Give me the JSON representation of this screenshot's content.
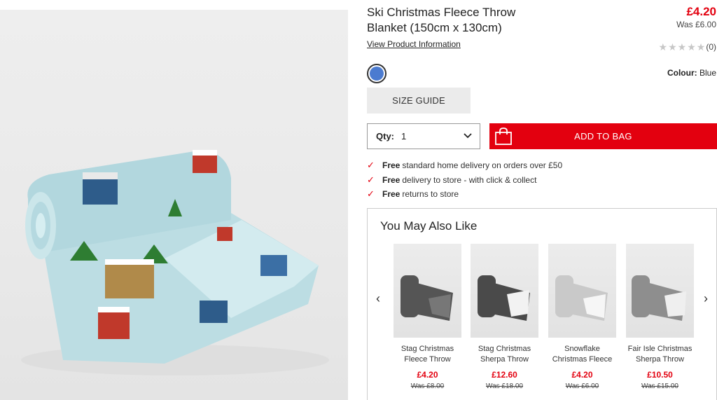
{
  "product": {
    "title": "Ski Christmas Fleece Throw Blanket (150cm x 130cm)",
    "price_now": "£4.20",
    "price_was": "Was £6.00",
    "view_info": "View Product Information",
    "rating_count": "(0)",
    "rating_value": 0,
    "colour_label": "Colour:",
    "colour_value": "Blue",
    "swatch_color": "#4b7bd0",
    "size_guide": "SIZE GUIDE",
    "qty_label": "Qty:",
    "qty_value": "1",
    "add_to_bag": "ADD TO BAG"
  },
  "benefits": [
    {
      "bold": "Free",
      "text": "standard home delivery on orders over £50"
    },
    {
      "bold": "Free",
      "text": "delivery to store - with click & collect"
    },
    {
      "bold": "Free",
      "text": "returns to store"
    }
  ],
  "ymal": {
    "title": "You May Also Like",
    "items": [
      {
        "name": "Stag Christmas Fleece Throw",
        "price": "£4.20",
        "was": "Was £8.00",
        "tone": "#555555"
      },
      {
        "name": "Stag Christmas Sherpa Throw",
        "price": "£12.60",
        "was": "Was £18.00",
        "tone": "#4a4a4a"
      },
      {
        "name": "Snowflake Christmas Fleece",
        "price": "£4.20",
        "was": "Was £6.00",
        "tone": "#c9c9c9"
      },
      {
        "name": "Fair Isle Christmas Sherpa Throw",
        "price": "£10.50",
        "was": "Was £15.00",
        "tone": "#8e8e8e"
      }
    ]
  },
  "colors": {
    "accent": "#e3000f"
  }
}
